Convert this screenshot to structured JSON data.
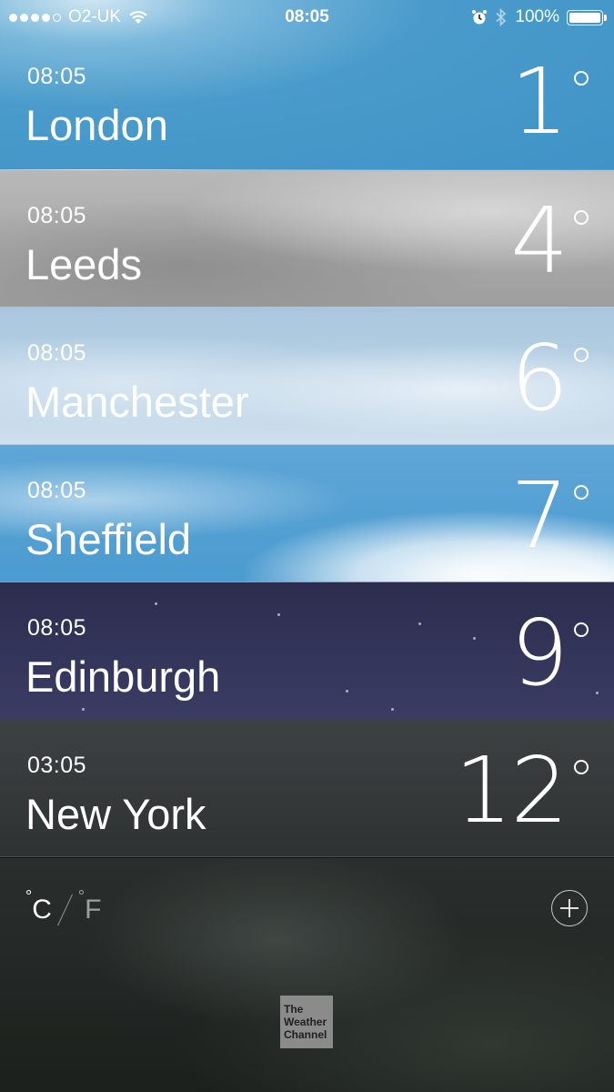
{
  "status_bar": {
    "carrier": "O2-UK",
    "time": "08:05",
    "battery": "100%",
    "battery_level": 1.0,
    "signal_dots_filled": 4,
    "signal_dots_total": 5
  },
  "cities": [
    {
      "time": "08:05",
      "name": "London",
      "temp": "1"
    },
    {
      "time": "08:05",
      "name": "Leeds",
      "temp": "4"
    },
    {
      "time": "08:05",
      "name": "Manchester",
      "temp": "6"
    },
    {
      "time": "08:05",
      "name": "Sheffield",
      "temp": "7"
    },
    {
      "time": "08:05",
      "name": "Edinburgh",
      "temp": "9"
    },
    {
      "time": "03:05",
      "name": "New York",
      "temp": "12"
    }
  ],
  "footer": {
    "unit_c": "C",
    "unit_f": "F",
    "logo_lines": [
      "The",
      "Weather",
      "Channel"
    ]
  },
  "colors": {
    "london_sky": "#4a9bcb",
    "edinburgh_night": "#2c2d4e",
    "newyork_overcast": "#3d4142"
  }
}
